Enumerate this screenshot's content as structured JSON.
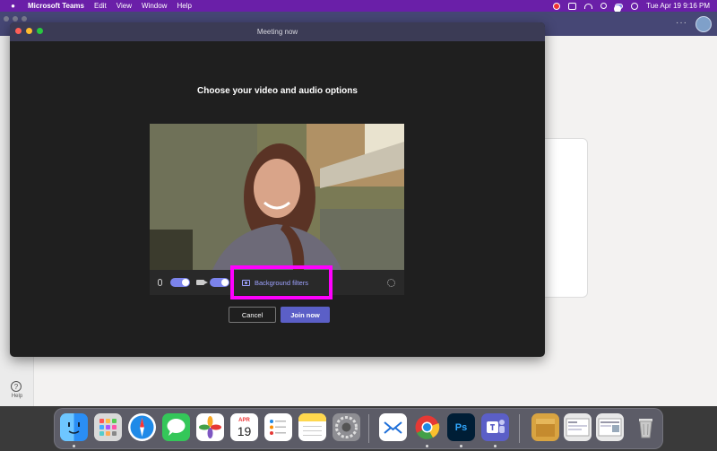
{
  "menubar": {
    "app_name": "Microsoft Teams",
    "items": [
      "Edit",
      "View",
      "Window",
      "Help"
    ],
    "clock": "Tue Apr 19  9:16 PM"
  },
  "teams": {
    "help_label": "Help",
    "more_label": "···"
  },
  "meeting": {
    "window_title": "Meeting now",
    "heading": "Choose your video and audio options",
    "background_filters_label": "Background filters",
    "cancel_label": "Cancel",
    "join_label": "Join now",
    "mic_on": true,
    "camera_on": true
  },
  "dock": {
    "calendar_month": "APR",
    "calendar_day": "19",
    "photoshop_label": "Ps",
    "apps": [
      {
        "name": "finder",
        "color": "#2a8ef5"
      },
      {
        "name": "launchpad",
        "color": "#d9d9d9"
      },
      {
        "name": "safari",
        "color": "#1f8ae8"
      },
      {
        "name": "messages",
        "color": "#34c759"
      },
      {
        "name": "photos",
        "color": "#ffffff"
      },
      {
        "name": "calendar",
        "color": "#ffffff"
      },
      {
        "name": "reminders",
        "color": "#ffffff"
      },
      {
        "name": "notes",
        "color": "#ffd84d"
      },
      {
        "name": "system-preferences",
        "color": "#8e8e93"
      },
      {
        "name": "mail-app",
        "color": "#ffffff"
      },
      {
        "name": "chrome",
        "color": "#ffffff"
      },
      {
        "name": "photoshop",
        "color": "#001e36"
      },
      {
        "name": "teams",
        "color": "#5b5fc7"
      },
      {
        "name": "archive",
        "color": "#d9a441"
      },
      {
        "name": "screenshot-1",
        "color": "#e8e8e8"
      },
      {
        "name": "screenshot-2",
        "color": "#e8e8e8"
      },
      {
        "name": "trash",
        "color": "#c9c9c9"
      }
    ]
  },
  "colors": {
    "menubar": "#6a1fa8",
    "accent": "#5b5fc7",
    "highlight": "#ff00ff",
    "link": "#9ea2ff"
  }
}
